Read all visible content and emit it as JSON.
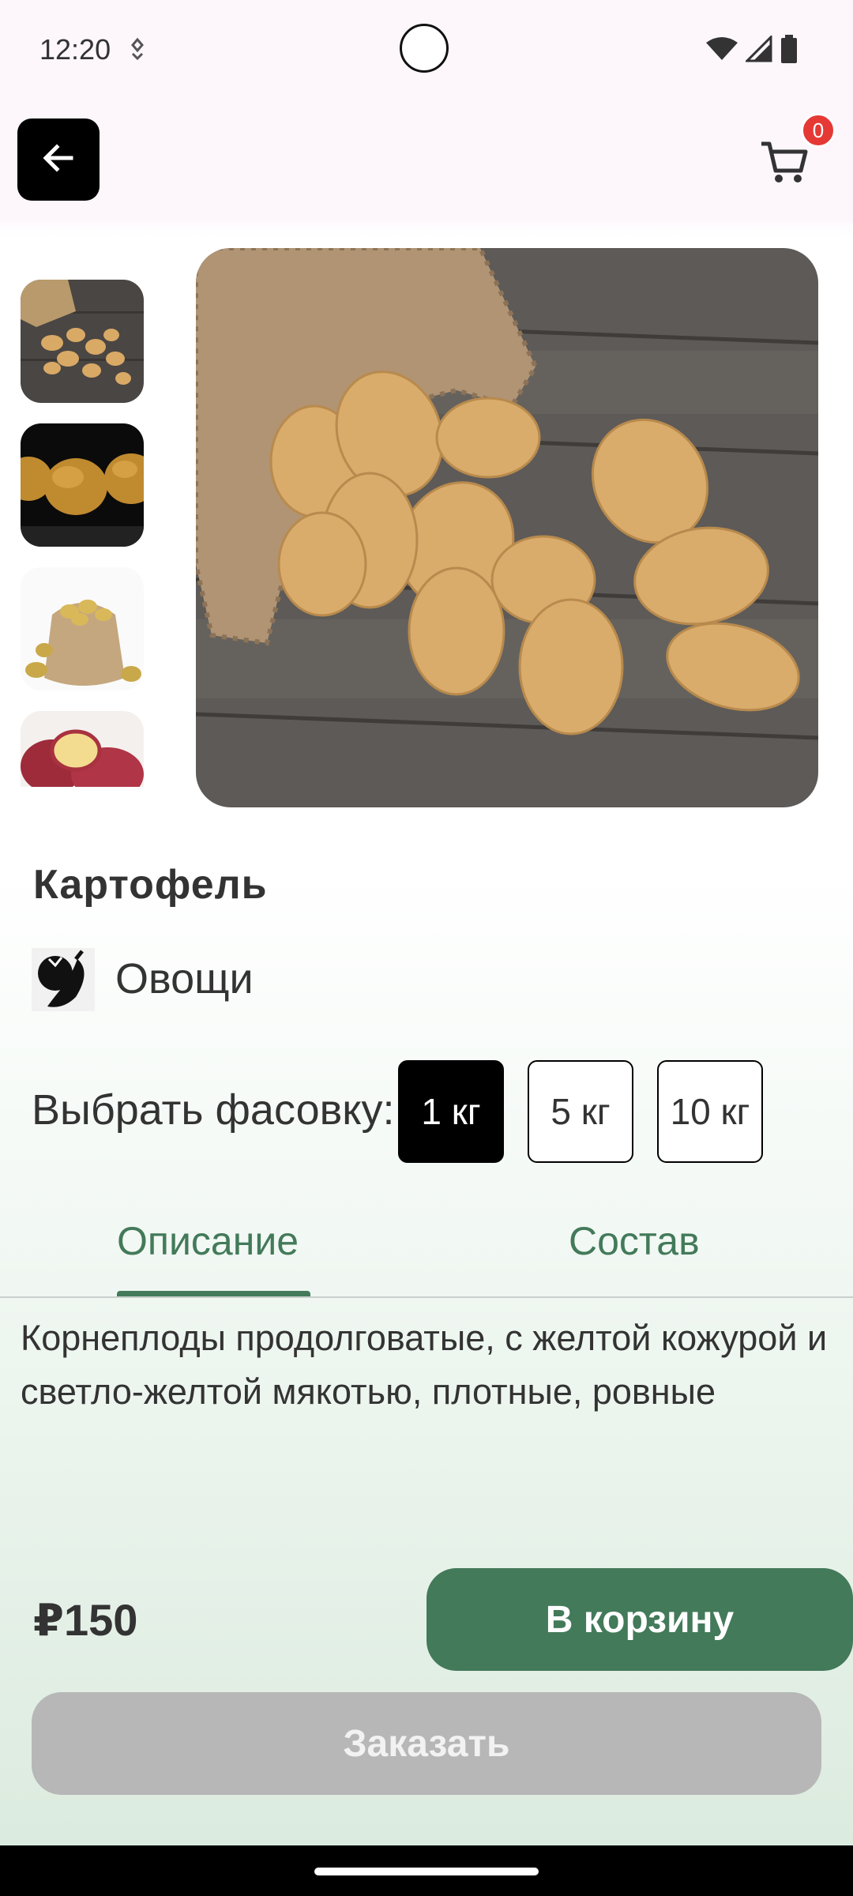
{
  "status_bar": {
    "time": "12:20"
  },
  "header": {
    "back_icon": "arrow-left-icon",
    "cart_icon": "cart-icon",
    "cart_count": "0"
  },
  "gallery": {
    "thumbnails": [
      "potatoes-on-board",
      "potatoes-on-black",
      "potato-sack",
      "red-potatoes"
    ],
    "main_image": "potatoes-spilling-from-burlap-sack"
  },
  "product": {
    "title": "Картофель",
    "category": {
      "icon": "vegetables-icon",
      "name": "Овощи"
    },
    "pack_label": "Выбрать фасовку:",
    "pack_options": [
      "1 кг",
      "5 кг",
      "10 кг"
    ],
    "selected_pack": "1 кг"
  },
  "tabs": {
    "items": [
      "Описание",
      "Состав"
    ],
    "active": "Описание"
  },
  "description": "Корнеплоды продолговатые, с желтой кожурой и светло-желтой мякотью, плотные, ровные",
  "footer": {
    "price": "₽150",
    "add_to_cart": "В корзину",
    "order": "Заказать"
  },
  "colors": {
    "accent": "#437a5a",
    "badge": "#e53935",
    "disabled": "#b7b7b7",
    "selected_pack_bg": "#000000"
  }
}
